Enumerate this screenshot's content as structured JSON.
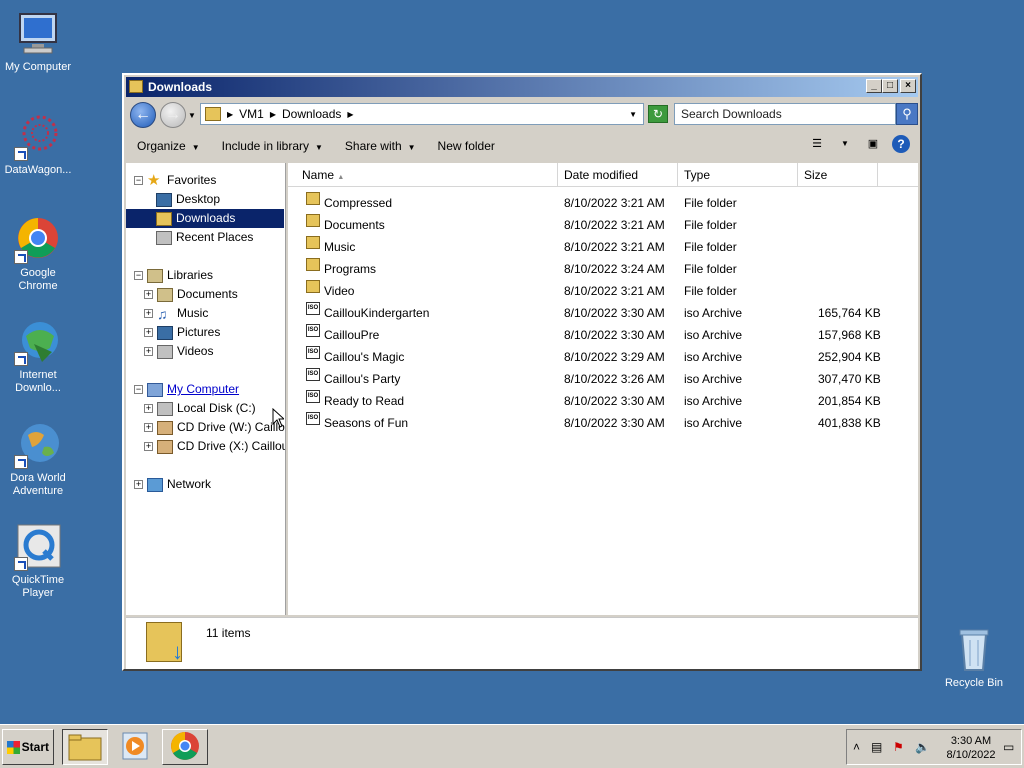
{
  "desktop": {
    "icons": [
      {
        "label": "My Computer"
      },
      {
        "label": "DataWagon..."
      },
      {
        "label": "Google Chrome"
      },
      {
        "label_line1": "Internet",
        "label_line2": "Downlo..."
      },
      {
        "label_line1": "Dora World",
        "label_line2": "Adventure"
      },
      {
        "label_line1": "QuickTime",
        "label_line2": "Player"
      },
      {
        "label": "Recycle Bin"
      }
    ]
  },
  "window": {
    "title": "Downloads",
    "controls": {
      "minimize": "_",
      "maximize": "□",
      "close": "×"
    }
  },
  "address": {
    "crumbs": [
      "VM1",
      "Downloads"
    ],
    "search_placeholder": "Search Downloads"
  },
  "toolbar": {
    "organize": "Organize",
    "include": "Include in library",
    "share": "Share with",
    "new_folder": "New folder"
  },
  "nav": {
    "favorites": "Favorites",
    "desktop": "Desktop",
    "downloads": "Downloads",
    "recent": "Recent Places",
    "libraries": "Libraries",
    "documents": "Documents",
    "music": "Music",
    "pictures": "Pictures",
    "videos": "Videos",
    "my_computer": "My Computer",
    "local_disk": "Local Disk (C:)",
    "cd_w": "CD Drive (W:) Caillou's",
    "cd_x": "CD Drive (X:) Caillou's",
    "network": "Network"
  },
  "columns": {
    "name": "Name",
    "date": "Date modified",
    "type": "Type",
    "size": "Size"
  },
  "files": [
    {
      "name": "Compressed",
      "date": "8/10/2022 3:21 AM",
      "type": "File folder",
      "size": ""
    },
    {
      "name": "Documents",
      "date": "8/10/2022 3:21 AM",
      "type": "File folder",
      "size": ""
    },
    {
      "name": "Music",
      "date": "8/10/2022 3:21 AM",
      "type": "File folder",
      "size": ""
    },
    {
      "name": "Programs",
      "date": "8/10/2022 3:24 AM",
      "type": "File folder",
      "size": ""
    },
    {
      "name": "Video",
      "date": "8/10/2022 3:21 AM",
      "type": "File folder",
      "size": ""
    },
    {
      "name": "CaillouKindergarten",
      "date": "8/10/2022 3:30 AM",
      "type": "iso Archive",
      "size": "165,764 KB"
    },
    {
      "name": "CaillouPre",
      "date": "8/10/2022 3:30 AM",
      "type": "iso Archive",
      "size": "157,968 KB"
    },
    {
      "name": "Caillou's Magic",
      "date": "8/10/2022 3:29 AM",
      "type": "iso Archive",
      "size": "252,904 KB"
    },
    {
      "name": "Caillou's Party",
      "date": "8/10/2022 3:26 AM",
      "type": "iso Archive",
      "size": "307,470 KB"
    },
    {
      "name": "Ready to Read",
      "date": "8/10/2022 3:30 AM",
      "type": "iso Archive",
      "size": "201,854 KB"
    },
    {
      "name": "Seasons of Fun",
      "date": "8/10/2022 3:30 AM",
      "type": "iso Archive",
      "size": "401,838 KB"
    }
  ],
  "details": {
    "count": "11 items"
  },
  "taskbar": {
    "start": "Start",
    "time": "3:30 AM",
    "date": "8/10/2022"
  }
}
